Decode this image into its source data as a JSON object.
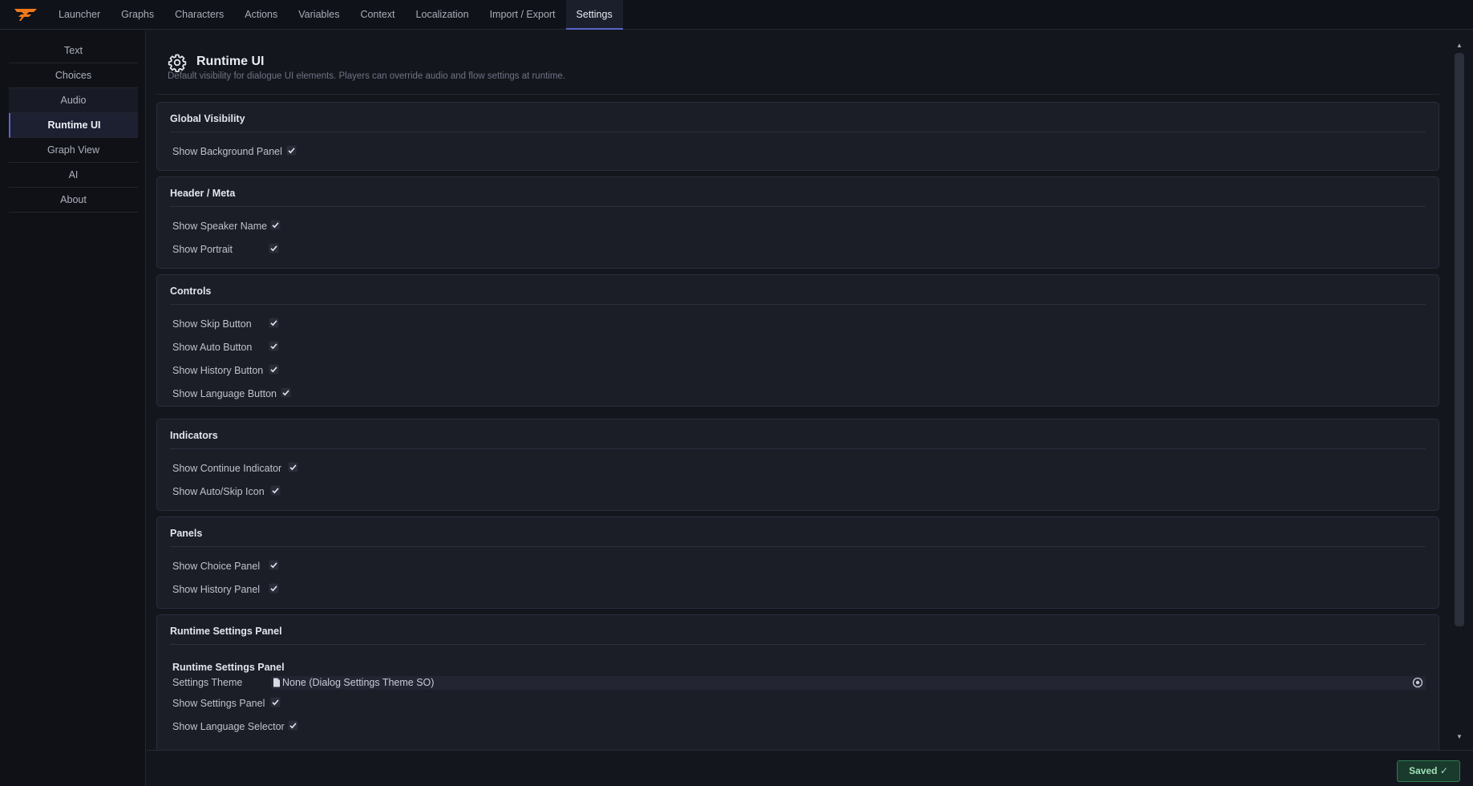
{
  "nav": {
    "tabs": [
      {
        "label": "Launcher"
      },
      {
        "label": "Graphs"
      },
      {
        "label": "Characters"
      },
      {
        "label": "Actions"
      },
      {
        "label": "Variables"
      },
      {
        "label": "Context"
      },
      {
        "label": "Localization"
      },
      {
        "label": "Import / Export"
      },
      {
        "label": "Settings"
      }
    ],
    "active_tab": "Settings"
  },
  "sidebar": {
    "items": [
      {
        "label": "Text"
      },
      {
        "label": "Choices"
      },
      {
        "label": "Audio"
      },
      {
        "label": "Runtime UI"
      },
      {
        "label": "Graph View"
      },
      {
        "label": "AI"
      },
      {
        "label": "About"
      }
    ],
    "active_item": "Runtime UI"
  },
  "page": {
    "icon": "gear-icon",
    "title": "Runtime UI",
    "description": "Default visibility for dialogue UI elements. Players can override audio and flow settings at runtime."
  },
  "sections": {
    "global": {
      "title": "Global Visibility",
      "fields": [
        {
          "label": "Show Background Panel",
          "checked": true
        }
      ]
    },
    "header": {
      "title": "Header / Meta",
      "fields": [
        {
          "label": "Show Speaker Name",
          "checked": true
        },
        {
          "label": "Show Portrait",
          "checked": true
        }
      ]
    },
    "controls": {
      "title": "Controls",
      "fields": [
        {
          "label": "Show Skip Button",
          "checked": true
        },
        {
          "label": "Show Auto Button",
          "checked": true
        },
        {
          "label": "Show History Button",
          "checked": true
        },
        {
          "label": "Show Language Button",
          "checked": true
        }
      ]
    },
    "indicators": {
      "title": "Indicators",
      "fields": [
        {
          "label": "Show Continue Indicator",
          "checked": true
        },
        {
          "label": "Show Auto/Skip Icon",
          "checked": true
        }
      ]
    },
    "panels": {
      "title": "Panels",
      "fields": [
        {
          "label": "Show Choice Panel",
          "checked": true
        },
        {
          "label": "Show History Panel",
          "checked": true
        }
      ]
    },
    "runtime_settings": {
      "title": "Runtime Settings Panel",
      "subtitle": "Runtime Settings Panel",
      "theme_label": "Settings Theme",
      "theme_value": "None (Dialog Settings Theme SO)",
      "fields": [
        {
          "label": "Show Settings Panel",
          "checked": true
        },
        {
          "label": "Show Language Selector",
          "checked": true
        }
      ]
    }
  },
  "footer": {
    "saved_label": "Saved"
  },
  "colors": {
    "accent": "#5a63c9",
    "logo": "#f07a1a",
    "saved_border": "#2f7a52"
  }
}
